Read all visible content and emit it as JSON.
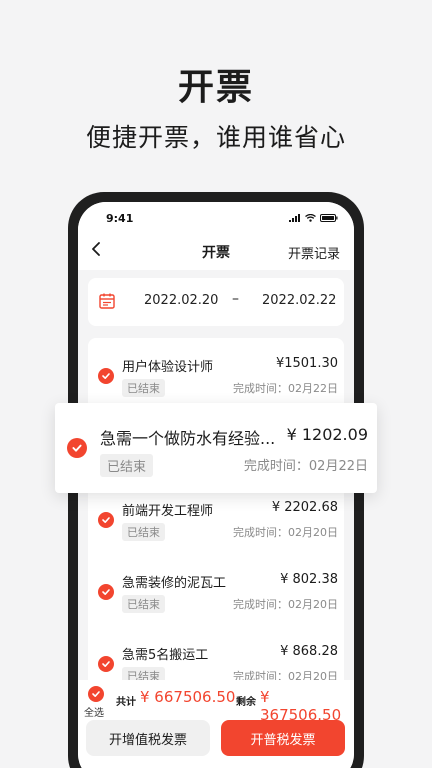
{
  "hero": {
    "title": "开票",
    "subtitle": "便捷开票，谁用谁省心"
  },
  "status_bar": {
    "time": "9:41"
  },
  "nav": {
    "title": "开票",
    "right_link": "开票记录"
  },
  "date_range": {
    "start": "2022.02.20",
    "separator": "–",
    "end": "2022.02.22"
  },
  "items": [
    {
      "title": "用户体验设计师",
      "price": "¥1501.30",
      "badge": "已结束",
      "time": "完成时间：02月22日",
      "checked": true
    },
    {
      "title": "急需一个做防水有经验...",
      "price": "¥ 1202.09",
      "badge": "已结束",
      "time": "完成时间：02月22日",
      "checked": true
    },
    {
      "title": "前端开发工程师",
      "price": "¥ 2202.68",
      "badge": "已结束",
      "time": "完成时间：02月20日",
      "checked": true
    },
    {
      "title": "急需装修的泥瓦工",
      "price": "¥ 802.38",
      "badge": "已结束",
      "time": "完成时间：02月20日",
      "checked": true
    },
    {
      "title": "急需5名搬运工",
      "price": "¥ 868.28",
      "badge": "已结束",
      "time": "完成时间：02月20日",
      "checked": true
    }
  ],
  "footer": {
    "select_all": "全选",
    "total_label": "共计",
    "total_value": "¥ 667506.50",
    "remain_label": "剩余",
    "remain_value": "¥ 367506.50",
    "btn_vat": "开增值税发票",
    "btn_normal": "开普税发票"
  },
  "colors": {
    "accent": "#f2452f",
    "background": "#f4f4f5",
    "phone_frame": "#1f1f1f"
  }
}
